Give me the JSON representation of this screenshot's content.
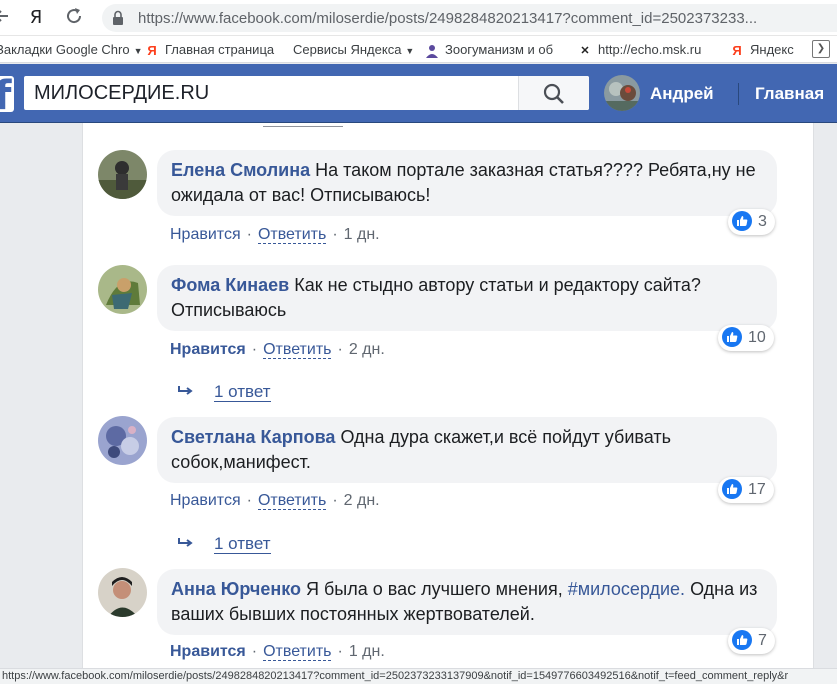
{
  "browser": {
    "url": "https://www.facebook.com/miloserdie/posts/2498284820213417?comment_id=2502373233...",
    "bookmarks": [
      {
        "label": "Закладки Google Chro",
        "icon": "folder-icon",
        "has_arrow": true
      },
      {
        "label": "Главная страница",
        "icon": "yandex-icon",
        "has_arrow": false
      },
      {
        "label": "Сервисы Яндекса",
        "icon": "none",
        "has_arrow": true
      },
      {
        "label": "Зоогуманизм и об",
        "icon": "person-icon",
        "has_arrow": false
      },
      {
        "label": "http://echo.msk.ru",
        "icon": "echo-icon",
        "has_arrow": false
      },
      {
        "label": "Яндекс",
        "icon": "yandex-icon",
        "has_arrow": false
      }
    ],
    "status_url": "https://www.facebook.com/miloserdie/posts/2498284820213417?comment_id=2502373233137909&notif_id=1549776603492516&notif_t=feed_comment_reply&r"
  },
  "header": {
    "logo": "f",
    "search_value": "МИЛОСЕРДИЕ.RU",
    "user_name": "Андрей",
    "home_label": "Главная"
  },
  "comments": [
    {
      "author": "Елена Смолина",
      "text": "На таком портале заказная статья???? Ребята,ну не ожидала от вас! Отписываюсь!",
      "like_label": "Нравится",
      "reply_label": "Ответить",
      "time": "1 дн.",
      "reactions": "3",
      "replies": "",
      "avatar_color": "#6f7a5a"
    },
    {
      "author": "Фома Кинаев",
      "text": "Как не стыдно автору статьи и редактору сайта? Отписываюсь",
      "like_label": "Нравится",
      "reply_label": "Ответить",
      "time": "2 дн.",
      "reactions": "10",
      "replies": "1 ответ",
      "avatar_color": "#7f9a5c"
    },
    {
      "author": "Светлана Карпова",
      "text": "Одна дура скажет,и всё пойдут убивать собок,манифест.",
      "like_label": "Нравится",
      "reply_label": "Ответить",
      "time": "2 дн.",
      "reactions": "17",
      "replies": "1 ответ",
      "avatar_color": "#7a86b8"
    },
    {
      "author": "Анна Юрченко",
      "text": "Я была о вас лучшего мнения, #милосердие. Одна из ваших бывших постоянных жертвователей.",
      "hashtag": "#милосердие.",
      "like_label": "Нравится",
      "reply_label": "Ответить",
      "time": "1 дн.",
      "reactions": "7",
      "replies": "",
      "avatar_color": "#3a4a3a"
    }
  ],
  "colors": {
    "fb_blue": "#4267b2",
    "link_blue": "#385898",
    "bubble_gray": "#f2f3f5",
    "like_blue": "#1877f2"
  }
}
